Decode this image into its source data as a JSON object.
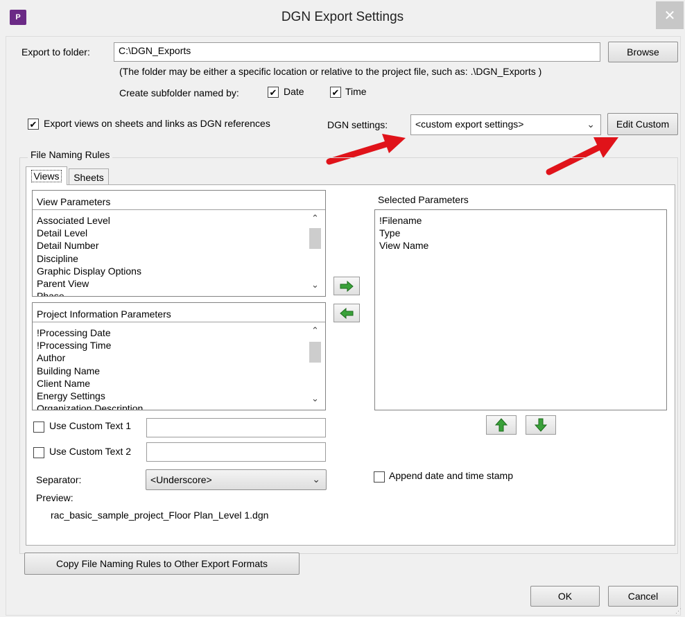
{
  "window": {
    "title": "DGN Export Settings",
    "app_icon_text": "P"
  },
  "export": {
    "folder_label": "Export to folder:",
    "folder_value": "C:\\DGN_Exports",
    "browse_label": "Browse",
    "hint": "(The folder may be either a specific location or relative to the project file, such as:  .\\DGN_Exports )",
    "subfolder_label": "Create subfolder named by:",
    "date_label": "Date",
    "date_checked": true,
    "time_label": "Time",
    "time_checked": true
  },
  "references": {
    "label": "Export views on sheets and links as DGN references",
    "checked": true
  },
  "dgn": {
    "settings_label": "DGN settings:",
    "settings_value": "<custom export settings>",
    "edit_label": "Edit Custom"
  },
  "naming": {
    "group_label": "File Naming Rules",
    "tabs": [
      {
        "label": "Views",
        "active": true
      },
      {
        "label": "Sheets",
        "active": false
      }
    ]
  },
  "view_params": {
    "header": "View Parameters",
    "items": [
      "Associated Level",
      "Detail Level",
      "Detail Number",
      "Discipline",
      "Graphic Display Options",
      "Parent View",
      "Phase"
    ]
  },
  "project_params": {
    "header": "Project Information Parameters",
    "items": [
      "!Processing Date",
      "!Processing Time",
      "Author",
      "Building Name",
      "Client Name",
      "Energy Settings",
      "Organization Description"
    ]
  },
  "selected_params": {
    "header": "Selected Parameters",
    "items": [
      "!Filename",
      "Type",
      "View Name"
    ]
  },
  "custom": {
    "text1_label": "Use Custom Text 1",
    "text1_value": "",
    "text2_label": "Use Custom Text 2",
    "text2_value": ""
  },
  "separator": {
    "label": "Separator:",
    "value": "<Underscore>"
  },
  "append": {
    "label": "Append date and time stamp",
    "checked": false
  },
  "preview": {
    "label": "Preview:",
    "value": "rac_basic_sample_project_Floor Plan_Level 1.dgn"
  },
  "footer": {
    "copy_label": "Copy File Naming Rules to Other Export Formats",
    "ok_label": "OK",
    "cancel_label": "Cancel"
  },
  "colors": {
    "accent_red": "#e0131a",
    "arrow_green": "#3aa13a",
    "check_mark": "✔"
  }
}
